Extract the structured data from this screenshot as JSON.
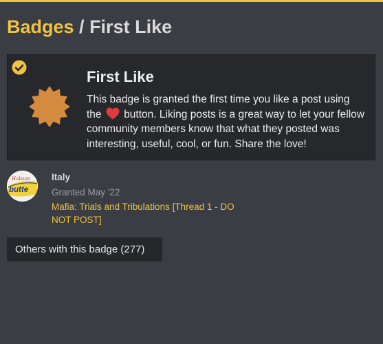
{
  "breadcrumb": {
    "parent_label": "Badges",
    "separator": " / ",
    "current_label": "First Like"
  },
  "badge": {
    "name": "First Like",
    "icon": "sun-badge-icon",
    "icon_color": "#d58b3f",
    "status_icon": "check-circle-icon",
    "description_before": "This badge is granted the first time you like a post using the",
    "description_after": "button. Liking posts is a great way to let your fellow community members know that what they posted was interesting, useful, cool, or fun. Share the love!",
    "inline_icon": "heart-icon"
  },
  "grant": {
    "user_name": "Italy",
    "granted_text": "Granted May '22",
    "topic_link": "Mafia: Trials and Tribulations [Thread 1 - DO NOT POST]",
    "avatar_text": "butte"
  },
  "others_button": "Others with this badge (277)",
  "colors": {
    "accent": "#f0c340",
    "background": "#3a3d43",
    "card": "#26282c",
    "heart": "#e0393e"
  }
}
